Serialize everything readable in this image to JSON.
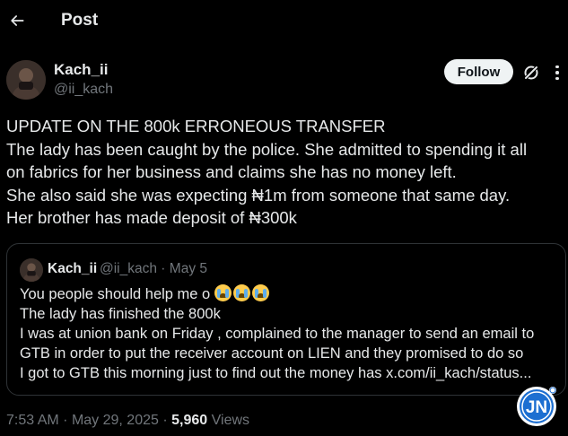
{
  "header": {
    "title": "Post"
  },
  "author": {
    "name": "Kach_ii",
    "handle": "@ii_kach"
  },
  "actions": {
    "follow_label": "Follow"
  },
  "post": {
    "lines": [
      "UPDATE ON THE 800k ERRONEOUS TRANSFER",
      "The lady has been caught by the police. She admitted to spending it all",
      "on fabrics for her business and claims she has no money left.",
      "She also said she was expecting ₦1m from someone that same day.",
      "Her brother has made deposit of  ₦300k"
    ]
  },
  "quote": {
    "name": "Kach_ii",
    "handle": "@ii_kach",
    "separator": "·",
    "date": "May 5",
    "first_line": "You people should help me o",
    "emoji_count": 3,
    "lines": [
      "The lady has finished the 800k",
      "I was at union bank on Friday , complained to the manager to send an email to",
      "GTB in order to put the receiver account on LIEN  and they promised to do so",
      "I got to GTB this morning just to find out the money has x.com/ii_kach/status..."
    ]
  },
  "footer": {
    "time": "7:53 AM",
    "separator": "·",
    "date": "May 29, 2025",
    "views_count": "5,960",
    "views_label": "Views"
  },
  "watermark": {
    "text": "JN"
  },
  "icons": {
    "back": "arrow-left-icon",
    "grok": "grok-icon",
    "more": "more-horizontal-icon"
  },
  "colors": {
    "background": "#000000",
    "text_primary": "#e7e9ea",
    "text_secondary": "#71767b",
    "border": "#2f3336",
    "follow_bg": "#eff3f4",
    "watermark_blue": "#1d6fd1"
  }
}
